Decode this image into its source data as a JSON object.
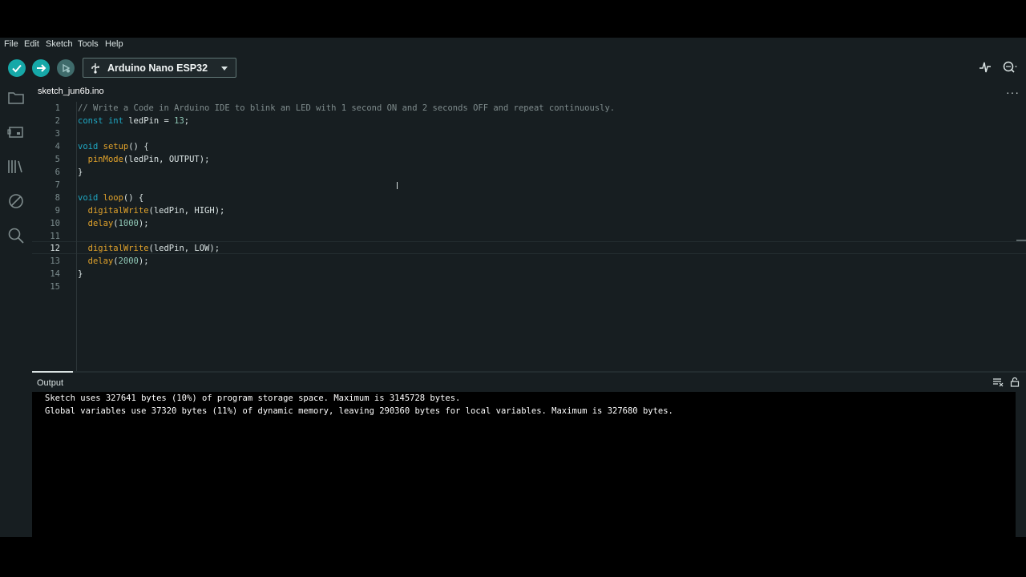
{
  "menu": [
    "File",
    "Edit",
    "Sketch",
    "Tools",
    "Help"
  ],
  "toolbar": {
    "board_name": "Arduino Nano ESP32",
    "verify_icon": "check-icon",
    "upload_icon": "arrow-right-icon",
    "debug_icon": "debug-icon",
    "serial_plotter_icon": "pulse-icon",
    "serial_monitor_icon": "magnifier-dotted-icon"
  },
  "sidebar": {
    "items": [
      "folder-icon",
      "board-icon",
      "library-icon",
      "debug-disabled-icon",
      "search-icon"
    ]
  },
  "tab": {
    "label": "sketch_jun6b.ino",
    "more": "···"
  },
  "editor": {
    "active_line": 12,
    "line_numbers": [
      "1",
      "2",
      "3",
      "4",
      "5",
      "6",
      "7",
      "8",
      "9",
      "10",
      "11",
      "12",
      "13",
      "14",
      "15"
    ],
    "lines": [
      "// Write a Code in Arduino IDE to blink an LED with 1 second ON and 2 seconds OFF and repeat continuously.",
      "const int ledPin = 13;",
      "",
      "void setup() {",
      "  pinMode(ledPin, OUTPUT);",
      "}",
      "",
      "void loop() {",
      "  digitalWrite(ledPin, HIGH);",
      "  delay(1000);",
      "",
      "  digitalWrite(ledPin, LOW);",
      "  delay(2000);",
      "}",
      ""
    ]
  },
  "output": {
    "title": "Output",
    "lines": [
      "Sketch uses 327641 bytes (10%) of program storage space. Maximum is 3145728 bytes.",
      "Global variables use 37320 bytes (11%) of dynamic memory, leaving 290360 bytes for local variables. Maximum is 327680 bytes."
    ]
  },
  "colors": {
    "accent": "#16a8a8",
    "background": "#171e21",
    "keyword": "#1fa8c4",
    "function": "#e2a32b",
    "number": "#8fc7b5",
    "comment": "#7f8c8d"
  }
}
